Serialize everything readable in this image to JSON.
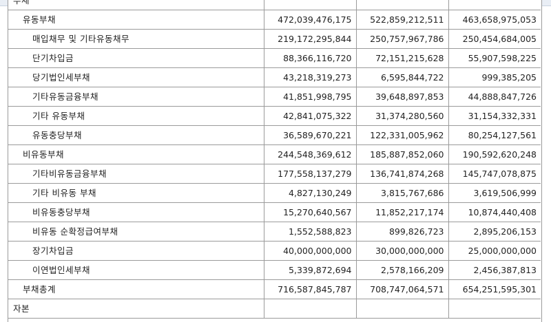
{
  "table": {
    "rows": [
      {
        "label": "부채",
        "level": 0,
        "values": [
          "",
          "",
          ""
        ]
      },
      {
        "label": "유동부채",
        "level": 1,
        "values": [
          "472,039,476,175",
          "522,859,212,511",
          "463,658,975,053"
        ]
      },
      {
        "label": "매입채무 및 기타유동채무",
        "level": 2,
        "values": [
          "219,172,295,844",
          "250,757,967,786",
          "250,454,684,005"
        ]
      },
      {
        "label": "단기차입금",
        "level": 2,
        "values": [
          "88,366,116,720",
          "72,151,215,628",
          "55,907,598,225"
        ]
      },
      {
        "label": "당기법인세부채",
        "level": 2,
        "values": [
          "43,218,319,273",
          "6,595,844,722",
          "999,385,205"
        ]
      },
      {
        "label": "기타유동금융부채",
        "level": 2,
        "values": [
          "41,851,998,795",
          "39,648,897,853",
          "44,888,847,726"
        ]
      },
      {
        "label": "기타 유동부채",
        "level": 2,
        "values": [
          "42,841,075,322",
          "31,374,280,560",
          "31,154,332,331"
        ]
      },
      {
        "label": "유동충당부채",
        "level": 2,
        "values": [
          "36,589,670,221",
          "122,331,005,962",
          "80,254,127,561"
        ]
      },
      {
        "label": "비유동부채",
        "level": 1,
        "values": [
          "244,548,369,612",
          "185,887,852,060",
          "190,592,620,248"
        ]
      },
      {
        "label": "기타비유동금융부채",
        "level": 2,
        "values": [
          "177,558,137,279",
          "136,741,874,268",
          "145,747,078,875"
        ]
      },
      {
        "label": "기타 비유동 부채",
        "level": 2,
        "values": [
          "4,827,130,249",
          "3,815,767,686",
          "3,619,506,999"
        ]
      },
      {
        "label": "비유동충당부채",
        "level": 2,
        "values": [
          "15,270,640,567",
          "11,852,217,174",
          "10,874,440,408"
        ]
      },
      {
        "label": "비유동 순확정급여부채",
        "level": 2,
        "values": [
          "1,552,588,823",
          "899,826,723",
          "2,895,206,153"
        ]
      },
      {
        "label": "장기차입금",
        "level": 2,
        "values": [
          "40,000,000,000",
          "30,000,000,000",
          "25,000,000,000"
        ]
      },
      {
        "label": "이연법인세부채",
        "level": 2,
        "values": [
          "5,339,872,694",
          "2,578,166,209",
          "2,456,387,813"
        ]
      },
      {
        "label": "부채총계",
        "level": 1,
        "values": [
          "716,587,845,787",
          "708,747,064,571",
          "654,251,595,301"
        ]
      },
      {
        "label": "자본",
        "level": 0,
        "values": [
          "",
          "",
          ""
        ]
      }
    ]
  }
}
